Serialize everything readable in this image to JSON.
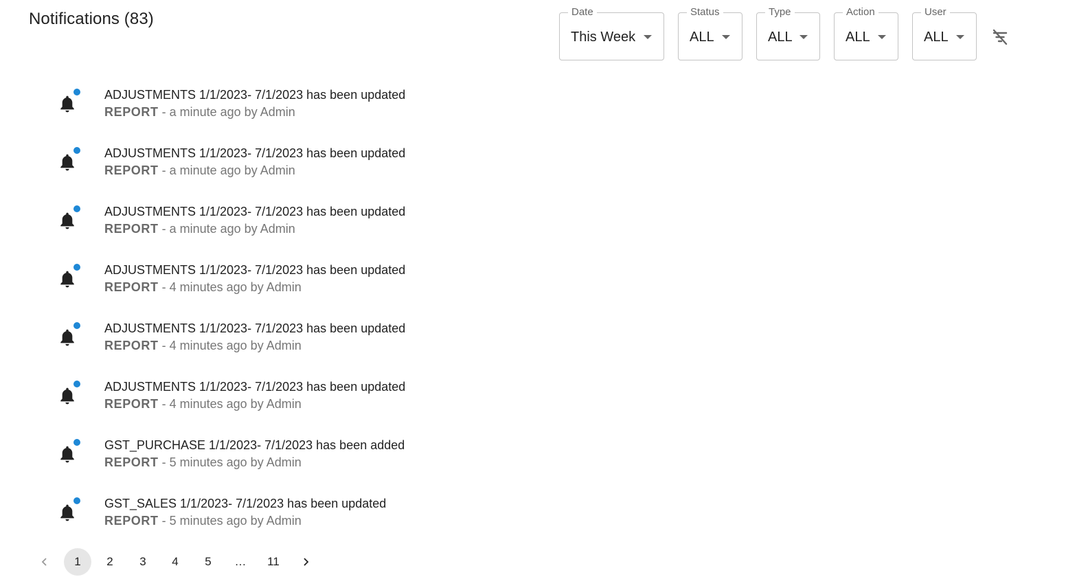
{
  "header": {
    "title": "Notifications (83)"
  },
  "filters": [
    {
      "label": "Date",
      "value": "This Week"
    },
    {
      "label": "Status",
      "value": "ALL"
    },
    {
      "label": "Type",
      "value": "ALL"
    },
    {
      "label": "Action",
      "value": "ALL"
    },
    {
      "label": "User",
      "value": "ALL"
    }
  ],
  "clear_filters_icon": "filter-off-icon",
  "notifications": [
    {
      "message": "ADJUSTMENTS 1/1/2023- 7/1/2023 has been updated",
      "type": "REPORT",
      "meta": " - a minute ago by Admin",
      "unread": true
    },
    {
      "message": "ADJUSTMENTS 1/1/2023- 7/1/2023 has been updated",
      "type": "REPORT",
      "meta": " - a minute ago by Admin",
      "unread": true
    },
    {
      "message": "ADJUSTMENTS 1/1/2023- 7/1/2023 has been updated",
      "type": "REPORT",
      "meta": " - a minute ago by Admin",
      "unread": true
    },
    {
      "message": "ADJUSTMENTS 1/1/2023- 7/1/2023 has been updated",
      "type": "REPORT",
      "meta": " - 4 minutes ago by Admin",
      "unread": true
    },
    {
      "message": "ADJUSTMENTS 1/1/2023- 7/1/2023 has been updated",
      "type": "REPORT",
      "meta": " - 4 minutes ago by Admin",
      "unread": true
    },
    {
      "message": "ADJUSTMENTS 1/1/2023- 7/1/2023 has been updated",
      "type": "REPORT",
      "meta": " - 4 minutes ago by Admin",
      "unread": true
    },
    {
      "message": "GST_PURCHASE 1/1/2023- 7/1/2023 has been added",
      "type": "REPORT",
      "meta": " - 5 minutes ago by Admin",
      "unread": true
    },
    {
      "message": "GST_SALES 1/1/2023- 7/1/2023 has been updated",
      "type": "REPORT",
      "meta": " - 5 minutes ago by Admin",
      "unread": true
    }
  ],
  "pagination": {
    "prev_icon": "chevron-left-icon",
    "next_icon": "chevron-right-icon",
    "pages": [
      "1",
      "2",
      "3",
      "4",
      "5",
      "…",
      "11"
    ],
    "current": "1"
  },
  "colors": {
    "unread_dot": "#1e88d6",
    "active_page_bg": "#e6e6e6"
  }
}
